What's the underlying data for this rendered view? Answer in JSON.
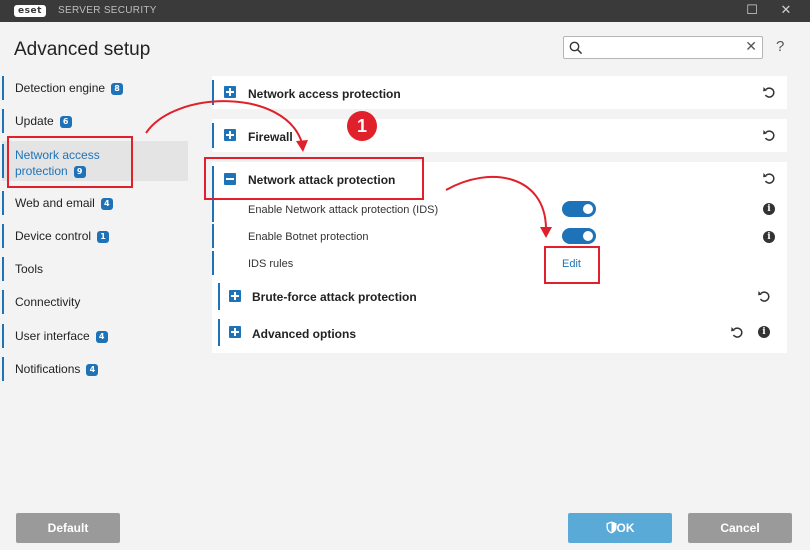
{
  "titlebar": {
    "logo": "eset",
    "app_name": "SERVER SECURITY",
    "minimize": "☐",
    "close": "✕"
  },
  "header": {
    "title": "Advanced setup",
    "search_value": "",
    "search_clear": "✕",
    "help": "?"
  },
  "sidebar": {
    "items": [
      {
        "label": "Detection engine",
        "badge": "8"
      },
      {
        "label": "Update",
        "badge": "6"
      },
      {
        "label": "Network access protection",
        "badge": "9",
        "active": true
      },
      {
        "label": "Web and email",
        "badge": "4"
      },
      {
        "label": "Device control",
        "badge": "1"
      },
      {
        "label": "Tools",
        "badge": ""
      },
      {
        "label": "Connectivity",
        "badge": ""
      },
      {
        "label": "User interface",
        "badge": "4"
      },
      {
        "label": "Notifications",
        "badge": "4"
      }
    ]
  },
  "main": {
    "sections": [
      {
        "title": "Network access protection"
      },
      {
        "title": "Firewall"
      },
      {
        "title": "Network attack protection",
        "rows": [
          {
            "label": "Enable Network attack protection (IDS)",
            "toggle": "on"
          },
          {
            "label": "Enable Botnet protection",
            "toggle": "on"
          },
          {
            "label": "IDS rules",
            "action": "Edit"
          }
        ],
        "subsections": [
          {
            "title": "Brute-force attack protection"
          },
          {
            "title": "Advanced options"
          }
        ]
      }
    ]
  },
  "annotation": {
    "step_number": "1"
  },
  "footer": {
    "default_label": "Default",
    "ok_label": "OK",
    "cancel_label": "Cancel"
  },
  "colors": {
    "accent": "#1e73b8",
    "highlight": "#e0202a",
    "titlebar": "#3a3a3a"
  }
}
